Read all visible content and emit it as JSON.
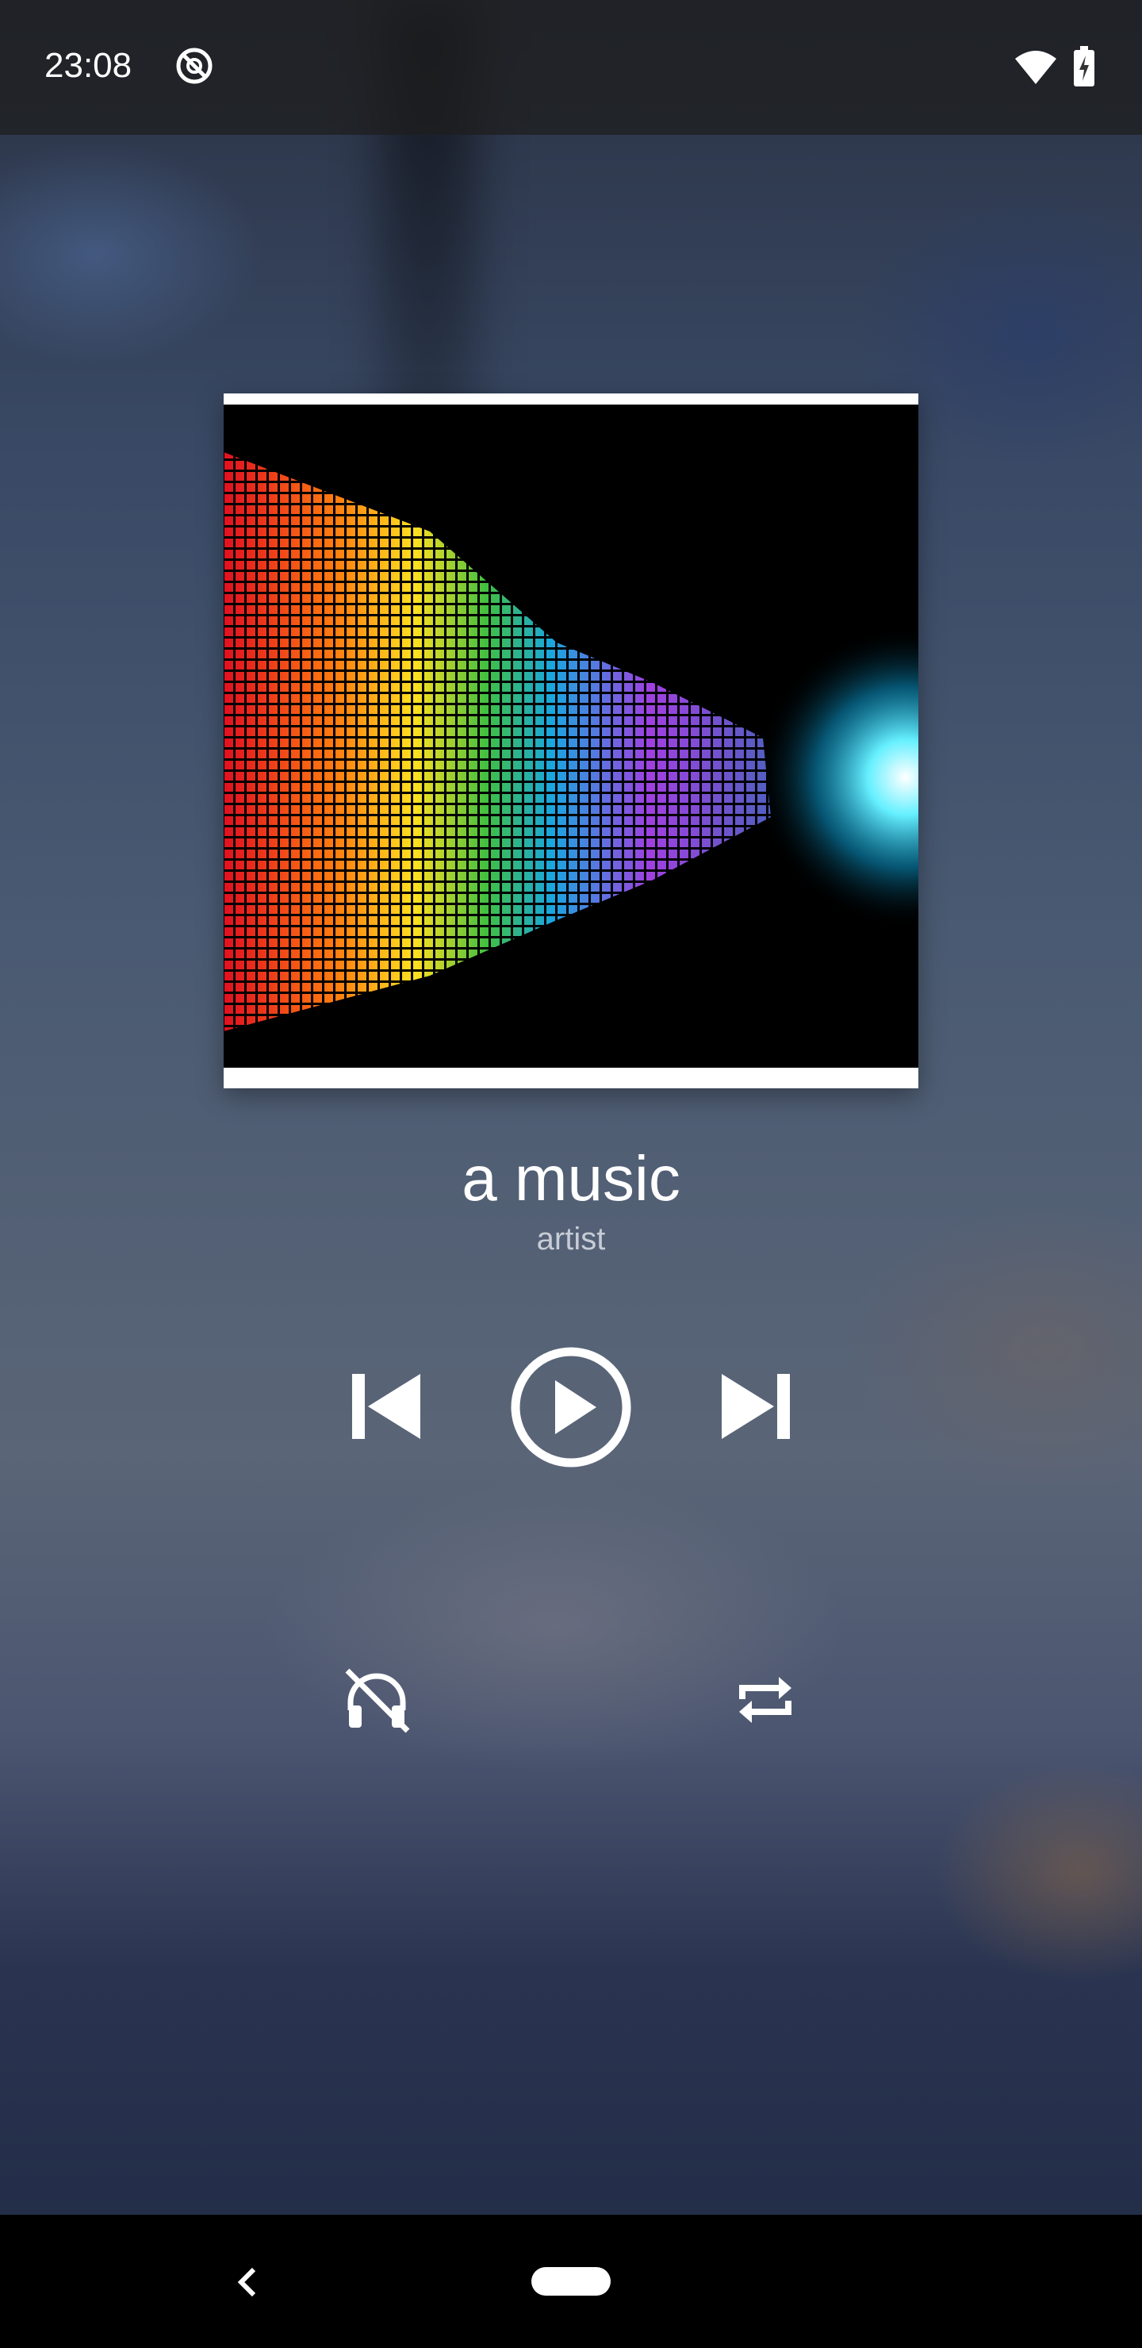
{
  "status_bar": {
    "time": "23:08",
    "icons": [
      "do-not-disturb-icon",
      "wifi-icon",
      "battery-charging-icon"
    ]
  },
  "track": {
    "title": "a music",
    "artist": "artist"
  },
  "controls": {
    "previous": "skip-previous-icon",
    "play": "play-circle-icon",
    "next": "skip-next-icon",
    "shuffle": "headphones-off-icon",
    "repeat": "repeat-icon"
  },
  "nav_bar": {
    "back": "back-chevron-icon",
    "home": "home-pill"
  },
  "colors": {
    "text_primary": "#ffffff",
    "text_secondary": "#c7ccd6",
    "nav_bg": "#000000"
  }
}
